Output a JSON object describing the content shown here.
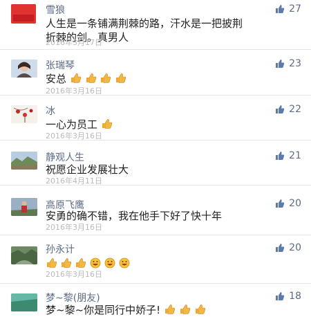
{
  "colors": {
    "name_color": "#5b6b86",
    "date_color": "#b9b9b9",
    "like_icon": "#5b7bb0",
    "separator": "#e6e6e6"
  },
  "comments": [
    {
      "name": "雪狼",
      "text_l1": "人生是一条铺满荆棘的路，汗水是一把披荆",
      "text_l2": "折棘的剑。真男人",
      "date": "2016年3月17日",
      "likes": "27",
      "avatar_text": "潜 哥 上线"
    },
    {
      "name": "张瑞琴",
      "text": "安总",
      "date": "2016年3月16日",
      "likes": "23",
      "emoji": "thumbs-up-emoji x4"
    },
    {
      "name": "冰",
      "text": "一心为员工",
      "date": "2016年3月16日",
      "likes": "22",
      "emoji": "thumbs-up-emoji x1"
    },
    {
      "name": "静观人生",
      "text": "祝愿企业发展壮大",
      "date": "2016年4月11日",
      "likes": "21"
    },
    {
      "name": "高原飞鹰",
      "text": "安勇的确不错，我在他手下好了快十年",
      "date": "2016年3月16日",
      "likes": "20"
    },
    {
      "name": "孙永计",
      "text": "",
      "date": "2016年3月16日",
      "likes": "20",
      "emoji": "thumbs-up-emoji x3, grin-emoji x3"
    },
    {
      "name": "梦~黎(朋友)",
      "text": "梦~黎~你是同行中娇子!",
      "date": "",
      "likes": "18",
      "emoji": "thumbs-up-emoji x3"
    }
  ]
}
